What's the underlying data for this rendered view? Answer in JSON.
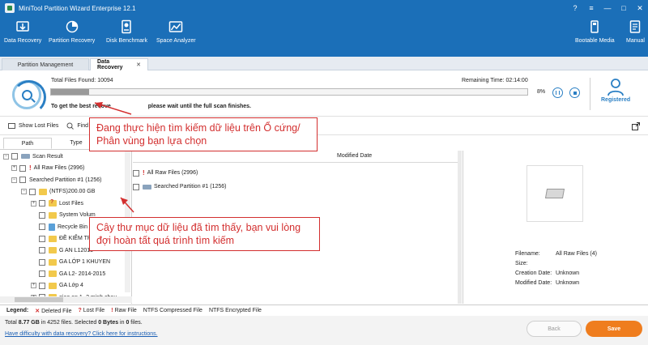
{
  "window": {
    "title": "MiniTool Partition Wizard Enterprise 12.1",
    "controls": [
      "?",
      "≡",
      "—",
      "□",
      "✕"
    ]
  },
  "toolbar": {
    "data_recovery": "Data Recovery",
    "partition_recovery": "Partition Recovery",
    "disk_benchmark": "Disk Benchmark",
    "space_analyzer": "Space Analyzer",
    "bootable_media": "Bootable Media",
    "manual": "Manual"
  },
  "tabs": {
    "partition_management": "Partition Management",
    "data_recovery": "Data Recovery",
    "close": "✕"
  },
  "scan": {
    "total_files_found": "Total Files Found:  10094",
    "remaining_time": "Remaining Time:  02:14:00",
    "percent": "8%",
    "progress": 0.08,
    "hint_start": "To get the best recove",
    "hint_end": "please wait until the full scan finishes.",
    "registered": "Registered"
  },
  "actions": {
    "show_lost_files": "Show Lost Files",
    "find": "Find"
  },
  "left_panel": {
    "tabs": [
      "Path",
      "Type"
    ],
    "tree": {
      "scan_result": "Scan Result",
      "all_raw_files": "All Raw Files (2996)",
      "searched_partition": "Searched Partition #1 (1256)",
      "ntfs": "(NTFS)200.00 GB",
      "lost_files": "Lost Files",
      "system_volume": "System Volum",
      "recycle_bin": "Recycle Bin",
      "de_kiem_tra": "ĐỀ KIỂM TRA",
      "ga_n": "G AN L12015",
      "ga_lop1": "GA  LỚP 1 KHUYEN",
      "ga_l2": "GA L2- 2014-2015",
      "ga_lop4": "GA Lớp 4",
      "giao_an": "giao an  1- 2 minh chau"
    }
  },
  "file_list": {
    "modified_date_header": "Modified Date",
    "rows": [
      "All Raw Files (2996)",
      "Searched Partition #1 (1256)"
    ]
  },
  "details": {
    "filename_label": "Filename:",
    "filename_value": "All Raw Files (4)",
    "size_label": "Size:",
    "creation_label": "Creation Date:",
    "creation_value": "Unknown",
    "modified_label": "Modified Date:",
    "modified_value": "Unknown"
  },
  "legend": {
    "label": "Legend:",
    "deleted": "Deleted File",
    "lost": "Lost File",
    "raw": "Raw File",
    "compressed": "NTFS Compressed File",
    "encrypted": "NTFS Encrypted File",
    "x_mark": "✕",
    "q_mark": "?",
    "e_mark": "!"
  },
  "footer": {
    "total_prefix": "Total ",
    "total_size": "8.77 GB",
    "total_mid": " in 4252 files.  Selected ",
    "selected_size": "0 Bytes",
    "selected_mid": " in ",
    "selected_files": "0",
    "total_suffix": " files.",
    "help_link": "Have difficulty with data recovery? Click here for instructions.",
    "back": "Back",
    "save": "Save"
  },
  "callouts": {
    "top": "Đang thực hiện tìm kiếm dữ liệu trên Ổ cứng/ Phân vùng bạn lựa chọn",
    "bottom": "Cây thư mục dữ liệu đã tìm thấy, bạn vui lòng đợi hoàn tất quá trình tìm kiếm"
  },
  "colors": {
    "title_bar": "#1b6fb8",
    "accent": "#2a7fc4",
    "save_button": "#ef7d1e",
    "callout": "#d32f2f"
  }
}
